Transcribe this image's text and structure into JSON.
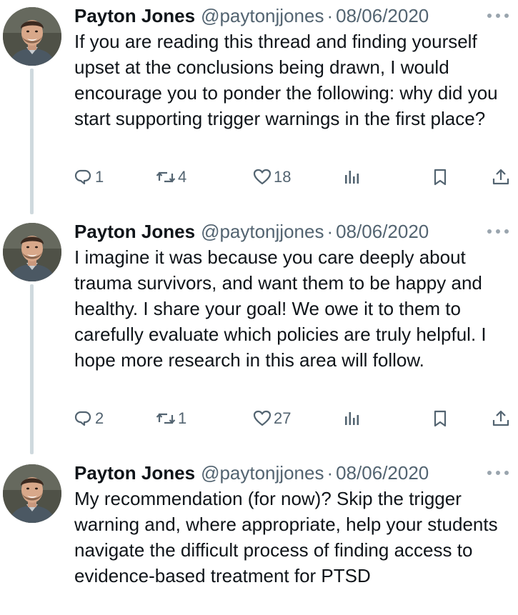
{
  "tweets": [
    {
      "author": {
        "name": "Payton Jones",
        "handle": "@paytonjjones"
      },
      "separator": "·",
      "date": "08/06/2020",
      "text": "If you are reading this thread and finding yourself upset at the conclusions being drawn, I would encourage you to ponder the following: why did you start supporting trigger warnings in the first place?",
      "replies": "1",
      "reposts": "4",
      "likes": "18"
    },
    {
      "author": {
        "name": "Payton Jones",
        "handle": "@paytonjjones"
      },
      "separator": "·",
      "date": "08/06/2020",
      "text": "I imagine it was because you care deeply about trauma survivors, and want them to be happy and healthy. I share your goal! We owe it to them to carefully evaluate which policies are truly helpful. I hope more research in this area will follow.",
      "replies": "2",
      "reposts": "1",
      "likes": "27"
    },
    {
      "author": {
        "name": "Payton Jones",
        "handle": "@paytonjjones"
      },
      "separator": "·",
      "date": "08/06/2020",
      "text": "My recommendation (for now)? Skip the trigger warning and, where appropriate, help your students navigate the difficult process of finding access to evidence-based treatment for PTSD"
    }
  ],
  "icons": {
    "reply": "reply-icon",
    "repost": "repost-icon",
    "like": "heart-icon",
    "views": "views-icon",
    "bookmark": "bookmark-icon",
    "share": "share-icon",
    "more": "more-icon"
  },
  "colors": {
    "text": "#0f1419",
    "secondary": "#536471",
    "thread_line": "#cfd9de"
  }
}
